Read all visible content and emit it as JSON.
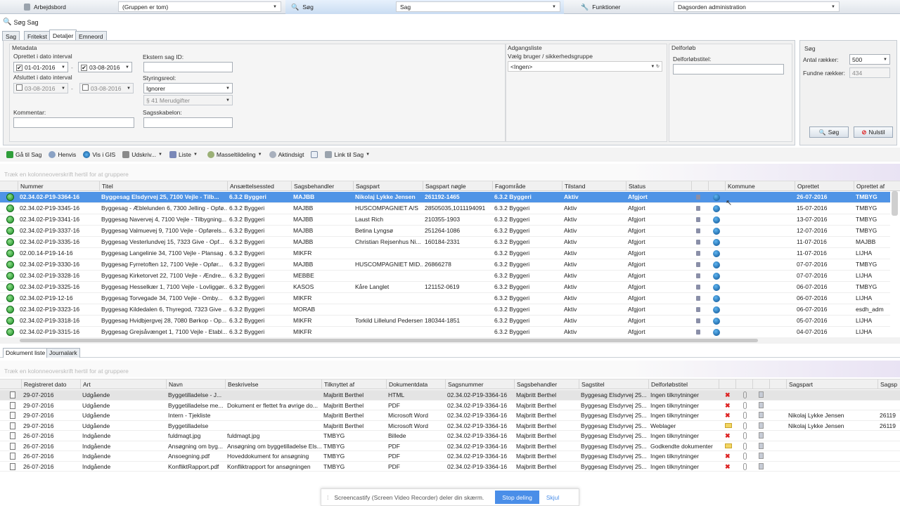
{
  "topbar": {
    "workbench_label": "Arbejdsbord",
    "workbench_value": "(Gruppen er tom)",
    "search_label": "Søg",
    "search_value": "Sag",
    "functions_label": "Funktioner",
    "functions_value": "Dagsorden administration"
  },
  "window_title": "Søg Sag",
  "tabs": [
    "Sag",
    "Fritekst",
    "Detaljer",
    "Emneord"
  ],
  "metadata": {
    "title": "Metadata",
    "created_label": "Oprettet i dato interval",
    "created_from": "01-01-2016",
    "created_to": "03-08-2016",
    "dash": "-",
    "closed_label": "Afsluttet i dato interval",
    "closed_from": "03-08-2016",
    "closed_to": "03-08-2016",
    "external_id_label": "Ekstern sag ID:",
    "external_id_value": "",
    "shelf_label": "Styringsreol:",
    "shelf_value": "Ignorer",
    "shelf_sub_value": "§ 41 Merudgifter",
    "comment_label": "Kommentar:",
    "comment_value": "",
    "template_label": "Sagsskabelon:",
    "template_value": ""
  },
  "access": {
    "title": "Adgangsliste",
    "label": "Vælg bruger / sikkerhedsgruppe",
    "value": "<Ingen>"
  },
  "delforloeb": {
    "title": "Delforløb",
    "label": "Delforløbstitel:",
    "value": ""
  },
  "sog": {
    "title": "Søg",
    "rows_label": "Antal rækker:",
    "rows_value": "500",
    "found_label": "Fundne rækker:",
    "found_value": "434",
    "search_button": "Søg",
    "reset_button": "Nulstil"
  },
  "toolbar": {
    "goto_case": "Gå til Sag",
    "refer": "Henvis",
    "gis": "Vis i GIS",
    "print": "Udskriv...",
    "list": "Liste",
    "mass": "Masseltildeling",
    "files": "Aktindsigt",
    "link": "Link til Sag"
  },
  "group_hint": "Træk en kolonneoverskrift hertil for at gruppere",
  "cases": {
    "columns": [
      "Nummer",
      "Titel",
      "Ansættelsessted",
      "Sagsbehandler",
      "Sagspart",
      "Sagspart nøgle",
      "Fagområde",
      "Tilstand",
      "Status",
      "",
      "",
      "Kommune",
      "Oprettet",
      "Oprettet af"
    ],
    "rows": [
      [
        "02.34.02-P19-3364-16",
        "Byggesag Elsdyrvej 25, 7100 Vejle - Tilb...",
        "6.3.2 Byggeri",
        "MAJBB",
        "Nikolaj Lykke Jensen",
        "261192-1465",
        "6.3.2 Byggeri",
        "Aktiv",
        "Afgjort",
        "26-07-2016",
        "TMBYG"
      ],
      [
        "02.34.02-P19-3345-16",
        "Byggesag - Æblelunden 6, 7300 Jelling - Opfø...",
        "6.3.2 Byggeri",
        "MAJBB",
        "HUSCOMPAGNIET A/S",
        "28505035,1011194091",
        "6.3.2 Byggeri",
        "Aktiv",
        "Afgjort",
        "15-07-2016",
        "TMBYG"
      ],
      [
        "02.34.02-P19-3341-16",
        "Byggesag Navervej 4, 7100 Vejle - Tilbygning...",
        "6.3.2 Byggeri",
        "MAJBB",
        "Laust Rich",
        "210355-1903",
        "6.3.2 Byggeri",
        "Aktiv",
        "Afgjort",
        "13-07-2016",
        "TMBYG"
      ],
      [
        "02.34.02-P19-3337-16",
        "Byggesag Valmuevej 9, 7100 Vejle - Opførels...",
        "6.3.2 Byggeri",
        "MAJBB",
        "Betina Lyngsø",
        "251264-1086",
        "6.3.2 Byggeri",
        "Aktiv",
        "Afgjort",
        "12-07-2016",
        "TMBYG"
      ],
      [
        "02.34.02-P19-3335-16",
        "Byggesag Vesterlundvej 15, 7323 Give - Opf...",
        "6.3.2 Byggeri",
        "MAJBB",
        "Christian Rejsenhus Ni...",
        "160184-2331",
        "6.3.2 Byggeri",
        "Aktiv",
        "Afgjort",
        "11-07-2016",
        "MAJBB"
      ],
      [
        "02.00.14-P19-14-16",
        "Byggesag Langelinie 34, 7100 Vejle - Plansag ...",
        "6.3.2 Byggeri",
        "MIKFR",
        "",
        "",
        "6.3.2 Byggeri",
        "Aktiv",
        "Afgjort",
        "11-07-2016",
        "LIJHA"
      ],
      [
        "02.34.02-P19-3330-16",
        "Byggesag Fyrretoften 12, 7100 Vejle - Opfør...",
        "6.3.2 Byggeri",
        "MAJBB",
        "HUSCOMPAGNIET MID...",
        "26866278",
        "6.3.2 Byggeri",
        "Aktiv",
        "Afgjort",
        "07-07-2016",
        "TMBYG"
      ],
      [
        "02.34.02-P19-3328-16",
        "Byggesag Kirketorvet 22, 7100 Vejle - Ændre...",
        "6.3.2 Byggeri",
        "MEBBE",
        "",
        "",
        "6.3.2 Byggeri",
        "Aktiv",
        "Afgjort",
        "07-07-2016",
        "LIJHA"
      ],
      [
        "02.34.02-P19-3325-16",
        "Byggesag Hesselkær 1, 7100 Vejle - Lovliggør...",
        "6.3.2 Byggeri",
        "KASOS",
        "Kåre Langlet",
        "121152-0619",
        "6.3.2 Byggeri",
        "Aktiv",
        "Afgjort",
        "06-07-2016",
        "TMBYG"
      ],
      [
        "02.34.02-P19-12-16",
        "Byggesag Torvegade 34, 7100 Vejle - Omby...",
        "6.3.2 Byggeri",
        "MIKFR",
        "",
        "",
        "6.3.2 Byggeri",
        "Aktiv",
        "Afgjort",
        "06-07-2016",
        "LIJHA"
      ],
      [
        "02.34.02-P19-3323-16",
        "Byggesag Kildedalen 6, Thyregod, 7323 Give ...",
        "6.3.2 Byggeri",
        "MORAB",
        "",
        "",
        "6.3.2 Byggeri",
        "Aktiv",
        "Afgjort",
        "06-07-2016",
        "esdh_adm"
      ],
      [
        "02.34.02-P19-3318-16",
        "Byggesag Hvidbjergvej 28, 7080 Børkop - Op...",
        "6.3.2 Byggeri",
        "MIKFR",
        "Torkild Lillelund Pedersen",
        "180344-1851",
        "6.3.2 Byggeri",
        "Aktiv",
        "Afgjort",
        "05-07-2016",
        "LIJHA"
      ],
      [
        "02.34.02-P19-3315-16",
        "Byggesag Grejsåvænget 1, 7100 Vejle - Etabl...",
        "6.3.2 Byggeri",
        "MIKFR",
        "",
        "",
        "6.3.2 Byggeri",
        "Aktiv",
        "Afgjort",
        "04-07-2016",
        "LIJHA"
      ]
    ]
  },
  "lower_tabs": [
    "Dokument liste",
    "Journalark"
  ],
  "documents": {
    "columns": [
      "Registreret dato",
      "Art",
      "Navn",
      "Beskrivelse",
      "Tilknyttet af",
      "Dokumentdata",
      "Sagsnummer",
      "Sagsbehandler",
      "Sagstitel",
      "Delforløbstitel",
      "",
      "",
      "",
      "",
      "Sagspart",
      "Sagsp"
    ],
    "rows": [
      [
        "29-07-2016",
        "Udgående",
        "Byggetilladelse - J...",
        "",
        "Majbritt Berthel",
        "HTML",
        "02.34.02-P19-3364-16",
        "Majbritt Berthel",
        "Byggesag Elsdyrvej 25...",
        "Ingen tilknytninger",
        "",
        "",
        "x"
      ],
      [
        "29-07-2016",
        "Udgående",
        "Byggetilladelse me...",
        "Dokument er flettet fra øvrige do...",
        "Majbritt Berthel",
        "PDF",
        "02.34.02-P19-3364-16",
        "Majbritt Berthel",
        "Byggesag Elsdyrvej 25...",
        "Ingen tilknytninger",
        "",
        "",
        "x"
      ],
      [
        "29-07-2016",
        "Udgående",
        "Intern - Tjekliste",
        "",
        "Majbritt Berthel",
        "Microsoft Word",
        "02.34.02-P19-3364-16",
        "Majbritt Berthel",
        "Byggesag Elsdyrvej 25...",
        "Ingen tilknytninger",
        "Nikolaj Lykke Jensen",
        "26119",
        "x"
      ],
      [
        "29-07-2016",
        "Udgående",
        "Byggetilladelse",
        "",
        "Majbritt Berthel",
        "Microsoft Word",
        "02.34.02-P19-3364-16",
        "Majbritt Berthel",
        "Byggesag Elsdyrvej 25...",
        "Weblager",
        "Nikolaj Lykke Jensen",
        "26119",
        "folder"
      ],
      [
        "26-07-2016",
        "Indgående",
        "fuldmagt.jpg",
        "fuldmagt.jpg",
        "TMBYG",
        "Billede",
        "02.34.02-P19-3364-16",
        "Majbritt Berthel",
        "Byggesag Elsdyrvej 25...",
        "Ingen tilknytninger",
        "",
        "",
        "x"
      ],
      [
        "26-07-2016",
        "Indgående",
        "Ansøgning om byg...",
        "Ansøgning om byggetilladelse Els...",
        "TMBYG",
        "PDF",
        "02.34.02-P19-3364-16",
        "Majbritt Berthel",
        "Byggesag Elsdyrvej 25...",
        "Godkendte dokumenter",
        "",
        "",
        "folder"
      ],
      [
        "26-07-2016",
        "Indgående",
        "Ansoegning.pdf",
        "Hoveddokument for ansøgning",
        "TMBYG",
        "PDF",
        "02.34.02-P19-3364-16",
        "Majbritt Berthel",
        "Byggesag Elsdyrvej 25...",
        "Ingen tilknytninger",
        "",
        "",
        "x"
      ],
      [
        "26-07-2016",
        "Indgående",
        "KonfliktRapport.pdf",
        "Konfliktrapport for ansøgningen",
        "TMBYG",
        "PDF",
        "02.34.02-P19-3364-16",
        "Majbritt Berthel",
        "Byggesag Elsdyrvej 25...",
        "Ingen tilknytninger",
        "",
        "",
        "x"
      ]
    ]
  },
  "castbar": {
    "message": "Screencastify (Screen Video Recorder) deler din skærm.",
    "stop": "Stop deling",
    "hide": "Skjul"
  }
}
